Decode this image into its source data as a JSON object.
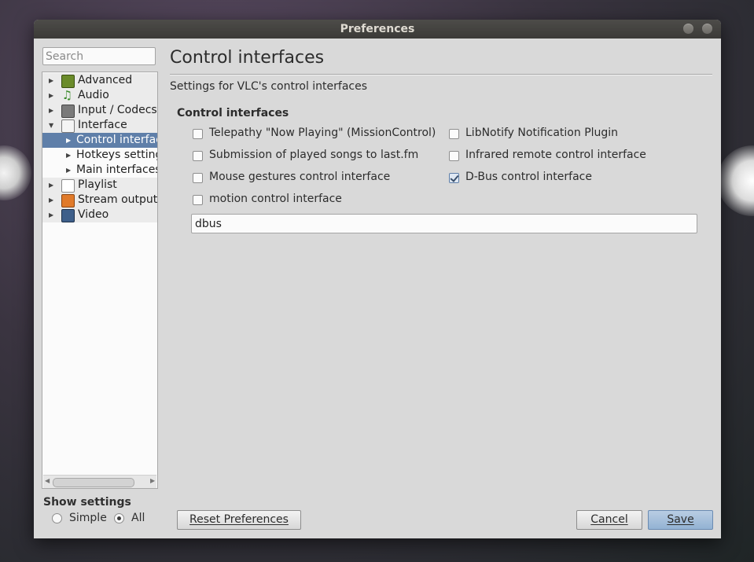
{
  "window": {
    "title": "Preferences"
  },
  "sidebar": {
    "search_placeholder": "Search",
    "items": [
      {
        "label": "Advanced",
        "icon": "chip-icon",
        "level": 0,
        "expanded": false
      },
      {
        "label": "Audio",
        "icon": "music-note-icon",
        "level": 0,
        "expanded": false
      },
      {
        "label": "Input / Codecs",
        "icon": "codec-icon",
        "level": 0,
        "expanded": false
      },
      {
        "label": "Interface",
        "icon": "interface-icon",
        "level": 0,
        "expanded": true
      },
      {
        "label": "Control interfaces",
        "level": 1,
        "selected": true
      },
      {
        "label": "Hotkeys settings",
        "level": 1
      },
      {
        "label": "Main interfaces",
        "level": 1
      },
      {
        "label": "Playlist",
        "icon": "playlist-icon",
        "level": 0,
        "expanded": false
      },
      {
        "label": "Stream output",
        "icon": "stream-output-icon",
        "level": 0,
        "expanded": false
      },
      {
        "label": "Video",
        "icon": "film-icon",
        "level": 0,
        "expanded": false
      }
    ],
    "show_settings_label": "Show settings",
    "modes": [
      {
        "label": "Simple",
        "selected": false
      },
      {
        "label": "All",
        "selected": true
      }
    ]
  },
  "panel": {
    "title": "Control interfaces",
    "subtitle": "Settings for VLC's control interfaces",
    "group_title": "Control interfaces",
    "options": [
      {
        "label": "Telepathy \"Now Playing\" (MissionControl)",
        "checked": false
      },
      {
        "label": "LibNotify Notification Plugin",
        "checked": false
      },
      {
        "label": "Submission of played songs to last.fm",
        "checked": false
      },
      {
        "label": "Infrared remote control interface",
        "checked": false
      },
      {
        "label": "Mouse gestures control interface",
        "checked": false
      },
      {
        "label": "D-Bus control interface",
        "checked": true
      },
      {
        "label": "motion control interface",
        "checked": false
      }
    ],
    "value_field": "dbus"
  },
  "buttons": {
    "reset": "Reset Preferences",
    "cancel": "Cancel",
    "save": "Save"
  },
  "colors": {
    "selection": "#5f7fa9",
    "window_bg": "#d9d9d9",
    "titlebar": "#3c3b37"
  }
}
